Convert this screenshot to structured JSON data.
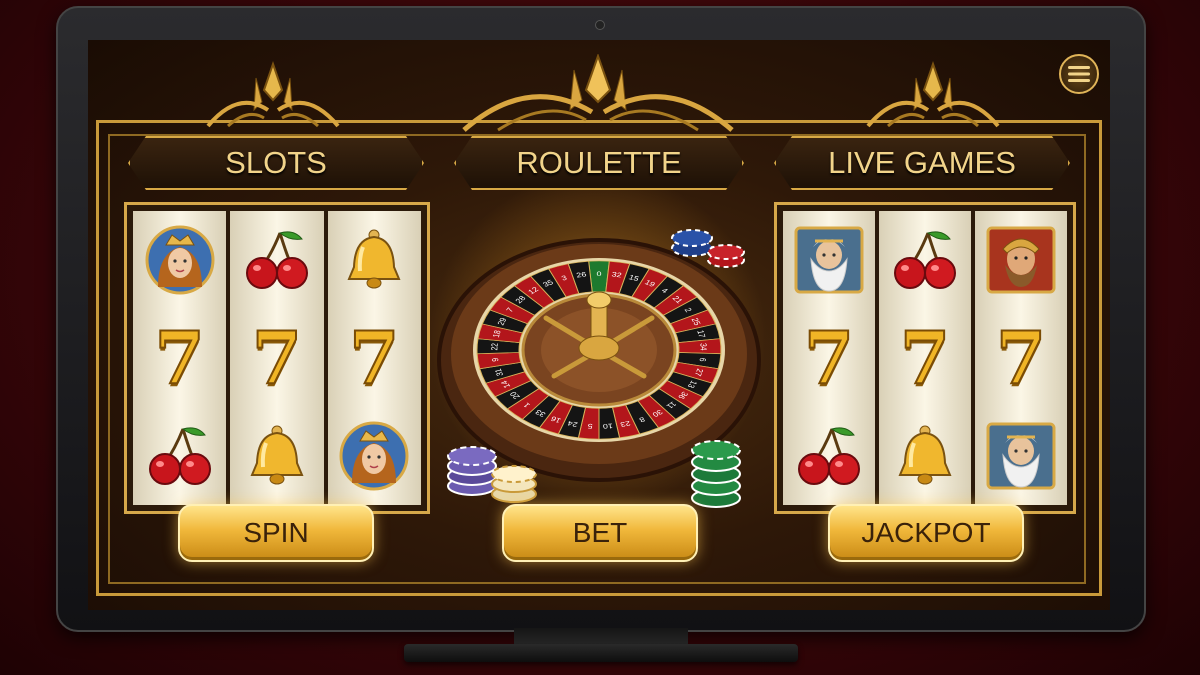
{
  "menu": {
    "icon": "hamburger-menu-icon"
  },
  "tabs": [
    {
      "label": "SLOTS"
    },
    {
      "label": "ROULETTE"
    },
    {
      "label": "LIVE GAMES"
    }
  ],
  "left_slot": {
    "reels": [
      [
        "queen-portrait-icon",
        "7",
        "cherry-icon"
      ],
      [
        "cherry-icon",
        "7",
        "bell-icon"
      ],
      [
        "bell-icon",
        "7",
        "queen-portrait-icon"
      ]
    ]
  },
  "right_slot": {
    "reels": [
      [
        "zeus-portrait-icon",
        "7",
        "cherry-icon"
      ],
      [
        "cherry-icon",
        "7",
        "bell-icon"
      ],
      [
        "warrior-portrait-icon",
        "7",
        "zeus-portrait-icon"
      ]
    ]
  },
  "buttons": {
    "spin": "SPIN",
    "bet": "BET",
    "jackpot": "JACKPOT"
  },
  "roulette": {
    "wheel_numbers": [
      "0",
      "32",
      "15",
      "19",
      "4",
      "21",
      "2",
      "25",
      "17",
      "34",
      "6",
      "27",
      "13",
      "36",
      "11",
      "30",
      "8",
      "23",
      "10",
      "5",
      "24",
      "16",
      "33",
      "1",
      "20",
      "14",
      "31",
      "9",
      "22",
      "18",
      "29",
      "7",
      "28",
      "12",
      "35",
      "3",
      "26"
    ]
  },
  "colors": {
    "gold": "#d8a945",
    "screen_bg": "#2e1808",
    "red": "#b3161b",
    "black": "#141414",
    "green": "#1d7a2e"
  }
}
